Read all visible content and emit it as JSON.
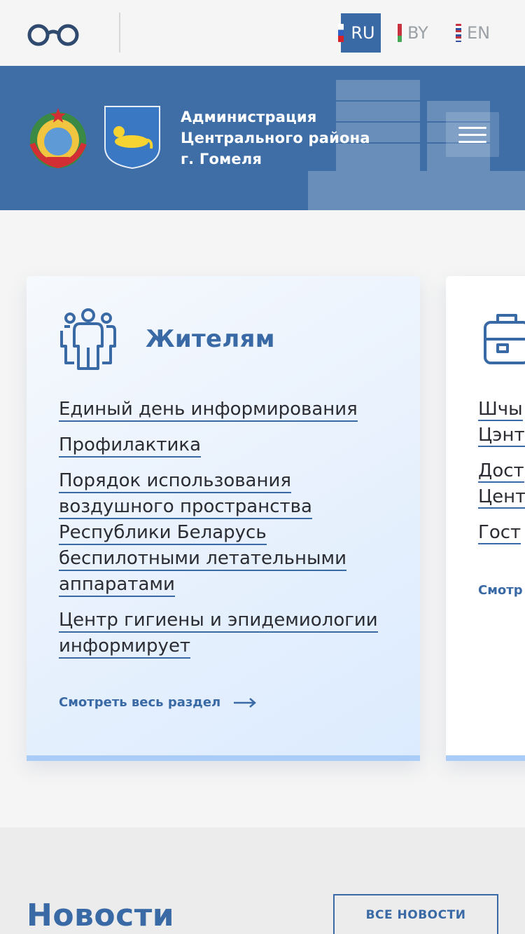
{
  "topbar": {
    "languages": [
      {
        "code": "RU",
        "active": true
      },
      {
        "code": "BY",
        "active": false
      },
      {
        "code": "EN",
        "active": false
      }
    ]
  },
  "header": {
    "org_name_line1": "Администрация",
    "org_name_line2": "Центрального района",
    "org_name_line3": "г. Гомеля"
  },
  "cards": [
    {
      "title": "Жителям",
      "icon": "people-icon",
      "links": [
        "Единый день информирования",
        "Профилактика",
        "Порядок использования воздушного пространства Республики Беларусь беспилотными летательными аппаратами",
        "Центр гигиены и эпидемиологии информирует"
      ],
      "view_all": "Смотреть весь раздел"
    },
    {
      "title": "",
      "icon": "briefcase-icon",
      "links": [
        "Шчы\nЦэнт",
        "Дост\nЦент",
        "Гост"
      ],
      "view_all": "Смотр"
    }
  ],
  "news": {
    "title": "Новости",
    "all_news_button": "ВСЕ НОВОСТИ"
  },
  "colors": {
    "brand_blue": "#3a6aa5",
    "header_blue": "#3f6ea7",
    "card_bottom": "#a9cdf6"
  }
}
